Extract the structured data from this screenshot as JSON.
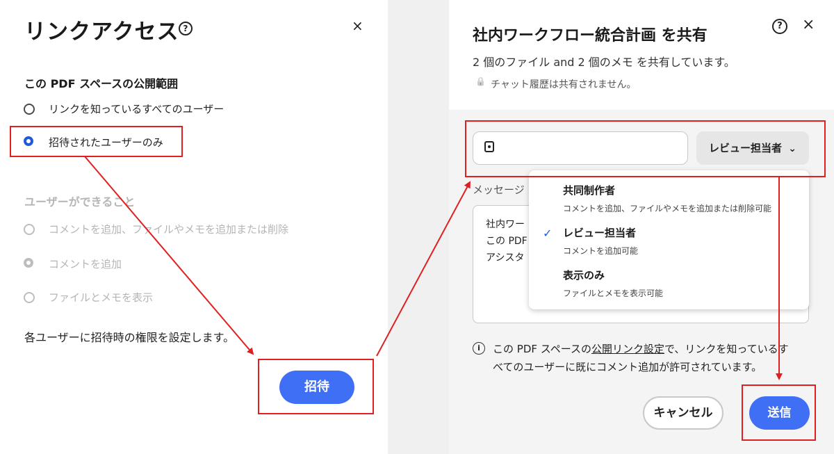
{
  "link_access_dialog": {
    "title": "リンクアクセス",
    "help_glyph": "?",
    "close_glyph": "×",
    "visibility_heading": "この PDF スペースの公開範囲",
    "visibility_options": [
      {
        "label": "リンクを知っているすべてのユーザー",
        "selected": false
      },
      {
        "label": "招待されたユーザーのみ",
        "selected": true
      }
    ],
    "permissions_heading": "ユーザーができること",
    "permission_options": [
      {
        "label": "コメントを追加、ファイルやメモを追加または削除",
        "selected": false,
        "disabled": true
      },
      {
        "label": "コメントを追加",
        "selected": true,
        "disabled": true
      },
      {
        "label": "ファイルとメモを表示",
        "selected": false,
        "disabled": true
      }
    ],
    "note": "各ユーザーに招待時の権限を設定します。",
    "invite_button": "招待"
  },
  "share_dialog": {
    "title": "社内ワークフロー統合計画 を共有",
    "help_glyph": "?",
    "close_glyph": "×",
    "subtitle": "2 個のファイル and 2 個のメモ を共有しています。",
    "chat_notice": "チャット履歴は共有されません。",
    "lock_glyph": "🔒",
    "recipient_input": {
      "value": "",
      "placeholder": ""
    },
    "role_button": "レビュー担当者",
    "chevron_glyph": "⌄",
    "message_label": "メッセージ",
    "message_lines": [
      "社内ワー",
      "この PDF",
      "アシスタ"
    ],
    "role_menu": [
      {
        "name": "共同制作者",
        "desc": "コメントを追加、ファイルやメモを追加または削除可能",
        "checked": false
      },
      {
        "name": "レビュー担当者",
        "desc": "コメントを追加可能",
        "checked": true
      },
      {
        "name": "表示のみ",
        "desc": "ファイルとメモを表示可能",
        "checked": false
      }
    ],
    "check_glyph": "✓",
    "info_glyph": "i",
    "info_text_1": "この PDF スペースの",
    "info_link": "公開リンク設定",
    "info_text_2": "で、リンクを知っているす",
    "info_text_3": "べてのユーザーに既にコメント追加が許可されています。",
    "cancel_button": "キャンセル",
    "send_button": "送信"
  },
  "colors": {
    "accent": "#3f6ff5",
    "radio_selected": "#1f5bd8",
    "annotation_red": "#e02020",
    "disabled_text": "#b5b5b5"
  }
}
